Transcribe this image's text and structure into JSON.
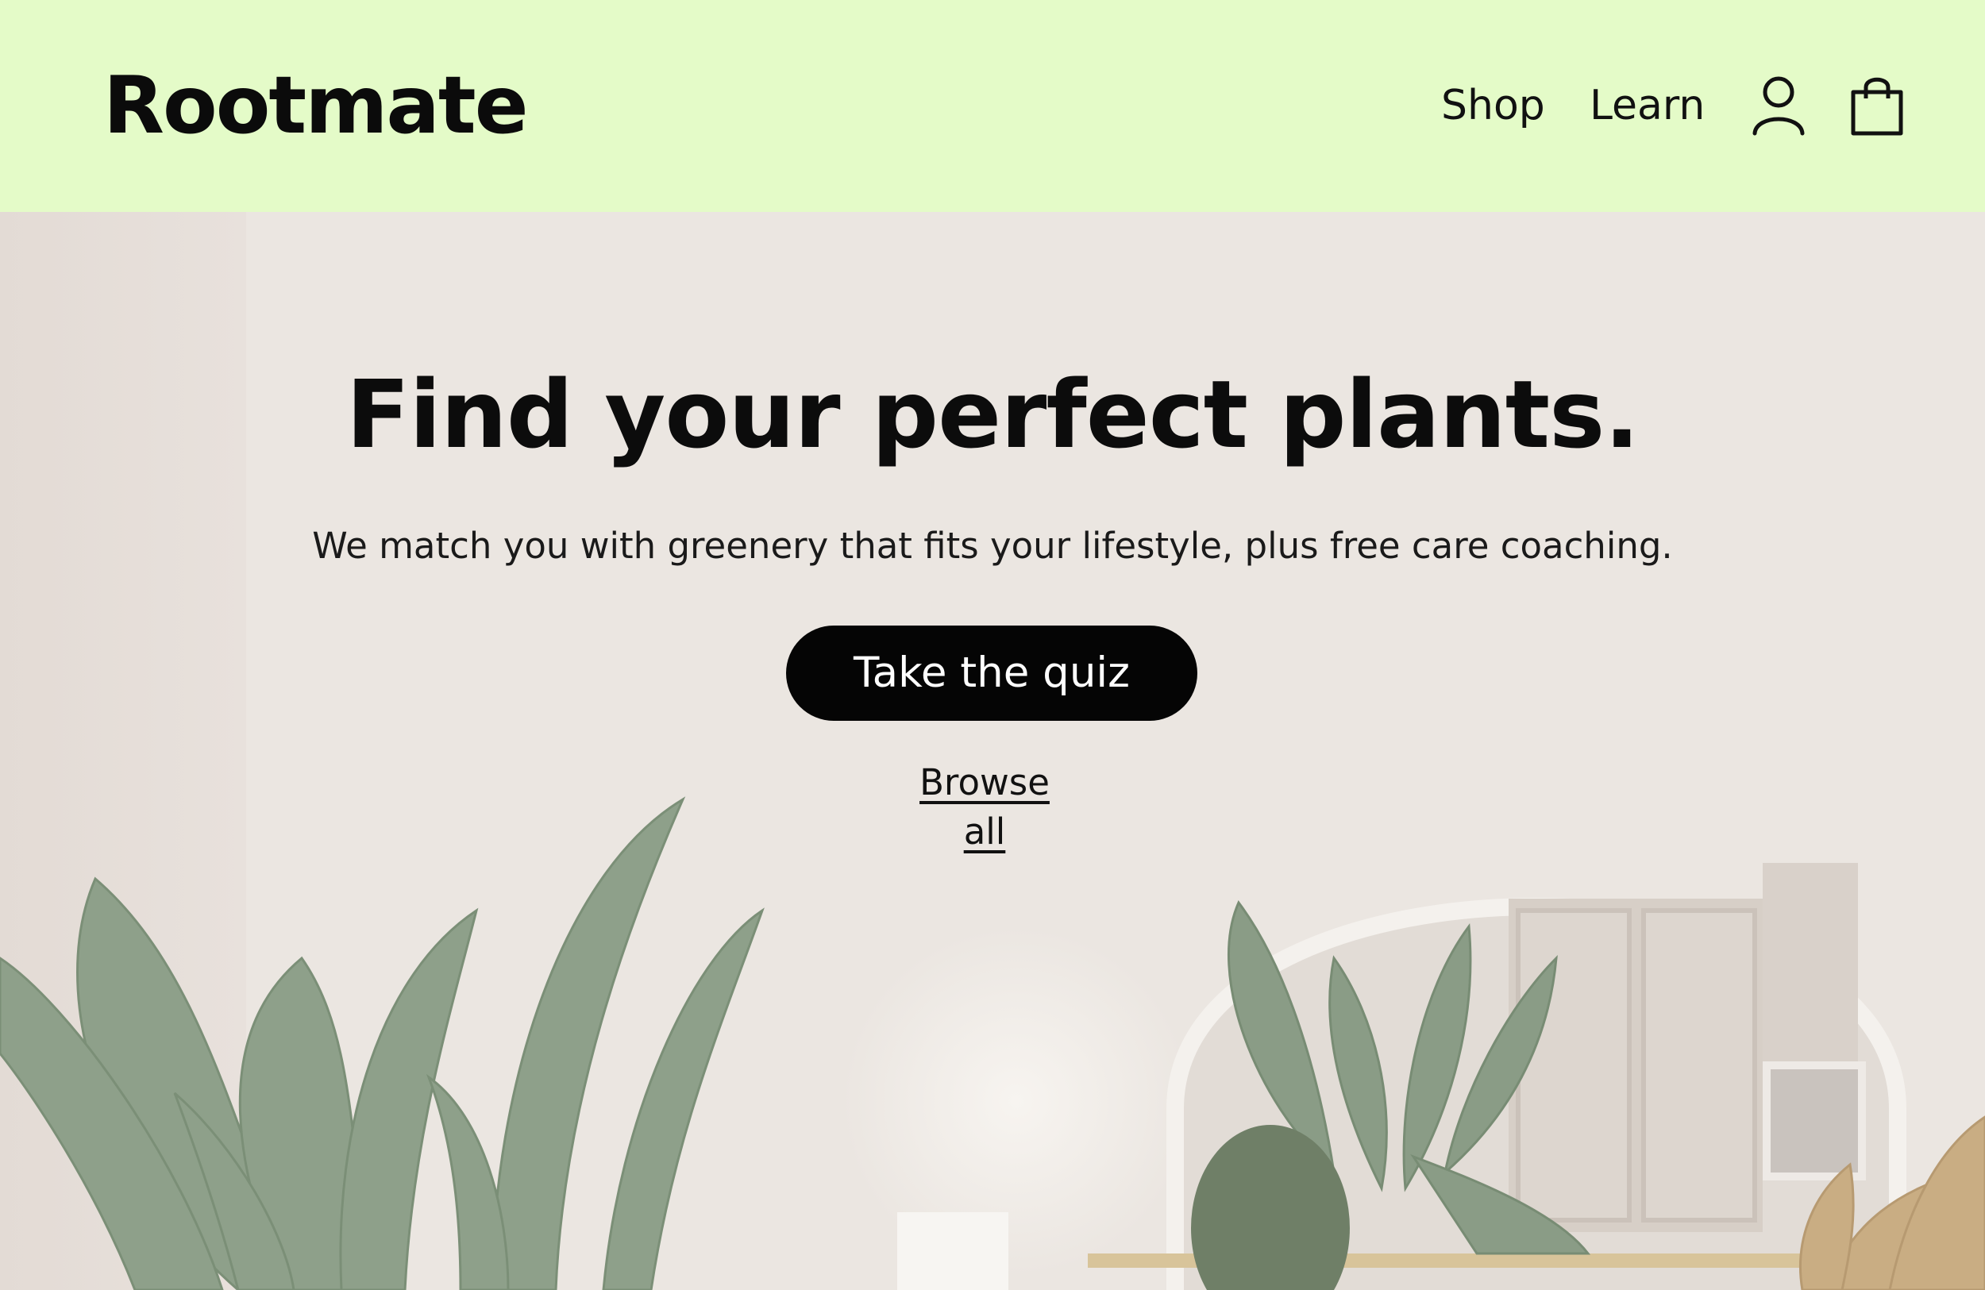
{
  "header": {
    "logo": "Rootmate",
    "nav": {
      "shop": "Shop",
      "learn": "Learn"
    },
    "icons": {
      "account": "user-icon",
      "cart": "shopping-bag-icon"
    },
    "background_color": "#e4fbc8"
  },
  "hero": {
    "headline": "Find your perfect plants.",
    "subheadline": "We match you with greenery that fits your lifestyle, plus free care coaching.",
    "primary_cta": "Take the quiz",
    "secondary_link": "Browse all",
    "cta_color": "#050505"
  }
}
